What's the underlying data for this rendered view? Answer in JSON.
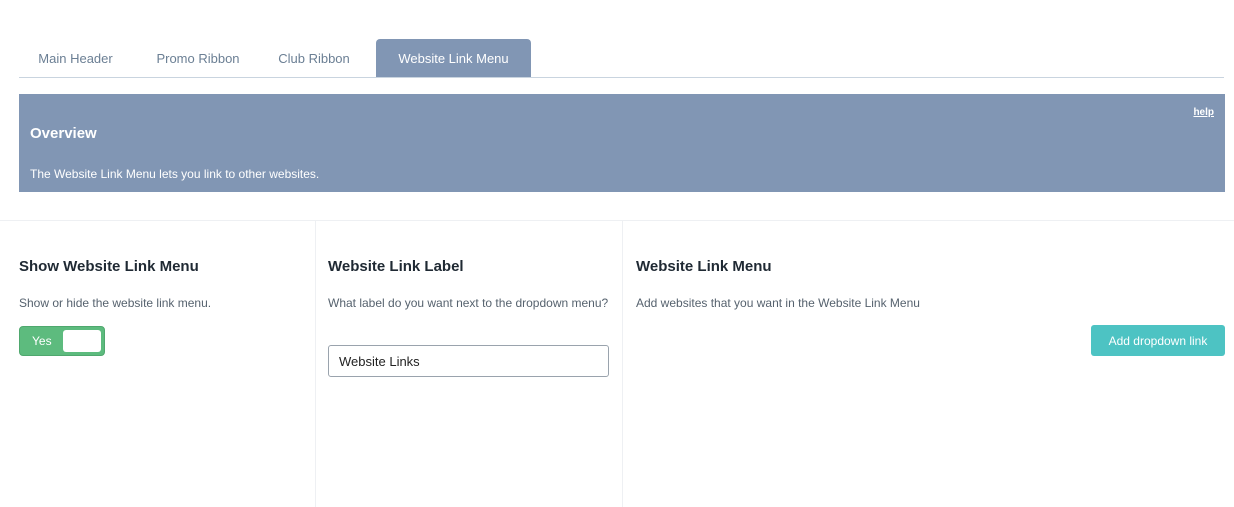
{
  "tabs": [
    {
      "label": "Main Header",
      "active": false
    },
    {
      "label": "Promo Ribbon",
      "active": false
    },
    {
      "label": "Club Ribbon",
      "active": false
    },
    {
      "label": "Website Link Menu",
      "active": true
    }
  ],
  "overview": {
    "title": "Overview",
    "text": "The Website Link Menu lets you link to other websites.",
    "help_label": "help"
  },
  "show_menu": {
    "title": "Show Website Link Menu",
    "description": "Show or hide the website link menu.",
    "toggle_label": "Yes",
    "toggle_on": true
  },
  "link_label": {
    "title": "Website Link Label",
    "description": "What label do you want next to the dropdown menu?",
    "input_value": "Website Links"
  },
  "link_menu": {
    "title": "Website Link Menu",
    "description": "Add websites that you want in the Website Link Menu",
    "add_button_label": "Add dropdown link"
  },
  "colors": {
    "tab_active_bg": "#8196b4",
    "overview_bg": "#8196b4",
    "toggle_bg": "#5dbb7e",
    "add_button_bg": "#4dc3c3"
  }
}
